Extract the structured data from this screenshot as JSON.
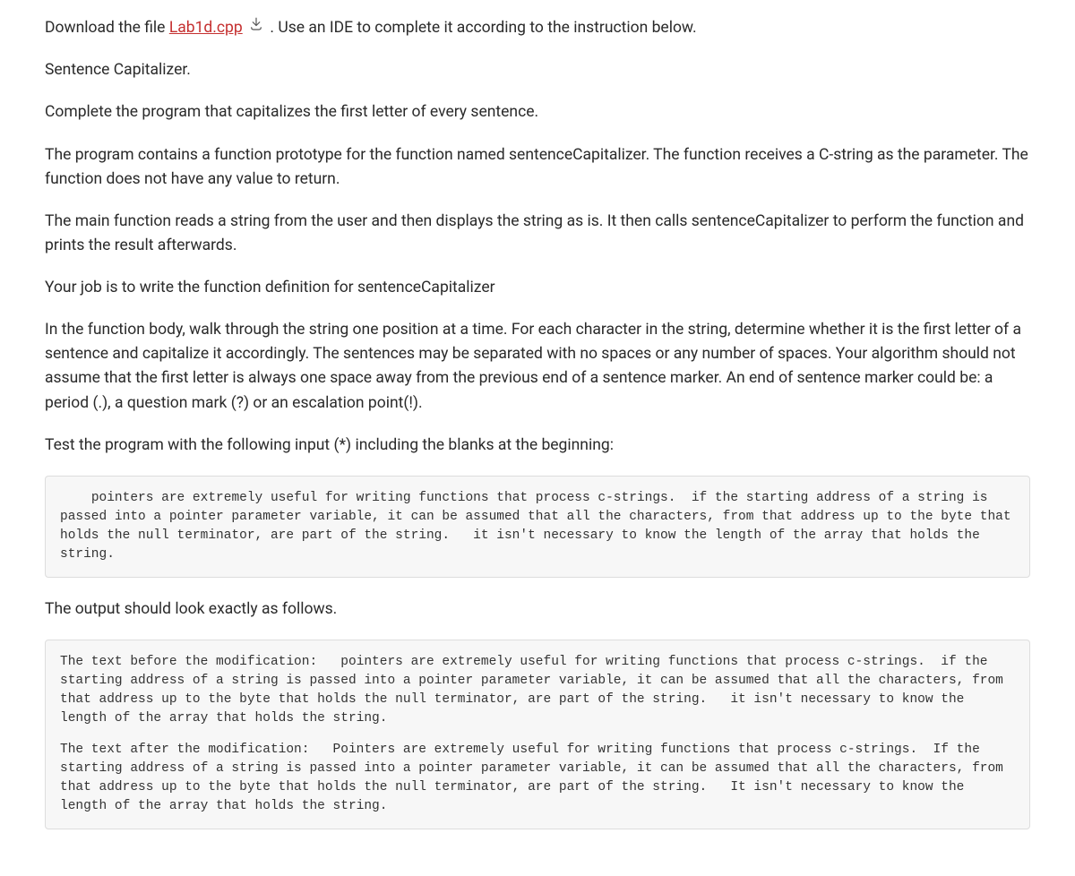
{
  "para1_prefix": "Download the file ",
  "file_link_text": "Lab1d.cpp",
  "para1_suffix": " . Use an IDE to complete it according to the instruction below.",
  "para2": "Sentence Capitalizer.",
  "para3": "Complete the program that capitalizes the first letter of every sentence.",
  "para4": "The program contains a function prototype for the function named sentenceCapitalizer. The function receives a C-string as the parameter. The function does not have any value to return.",
  "para5": "The main function reads a string from the user and then displays the string as is. It then calls sentenceCapitalizer to perform the function and prints the result afterwards.",
  "para6": "Your job is to write the function definition for sentenceCapitalizer",
  "para7": "In the function body, walk through the string one position at a time. For each character in the string, determine whether it is the first letter of a sentence and capitalize it accordingly. The sentences may be separated with no spaces or any number of spaces. Your algorithm should not assume that the first letter is always one space away from the previous end of a sentence marker. An end of sentence marker could be: a period (.), a question mark (?) or an escalation point(!).",
  "para8": "Test the program with the following input (*) including the blanks at the beginning:",
  "code_input": "    pointers are extremely useful for writing functions that process c-strings.  if the starting address of a string is passed into a pointer parameter variable, it can be assumed that all the characters, from that address up to the byte that holds the null terminator, are part of the string.   it isn't necessary to know the length of the array that holds the string.",
  "para9": "The output should look exactly as follows.",
  "code_output_block1": "The text before the modification:   pointers are extremely useful for writing functions that process c-strings.  if the starting address of a string is passed into a pointer parameter variable, it can be assumed that all the characters, from that address up to the byte that holds the null terminator, are part of the string.   it isn't necessary to know the length of the array that holds the string.",
  "code_output_block2": "The text after the modification:   Pointers are extremely useful for writing functions that process c-strings.  If the starting address of a string is passed into a pointer parameter variable, it can be assumed that all the characters, from that address up to the byte that holds the null terminator, are part of the string.   It isn't necessary to know the length of the array that holds the string."
}
